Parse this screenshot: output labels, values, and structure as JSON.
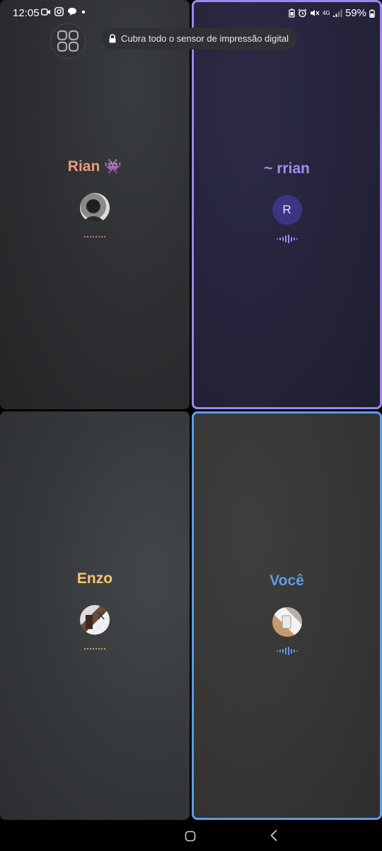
{
  "status_bar": {
    "time": "12:05",
    "left_icons": [
      "video-icon",
      "instagram-icon",
      "chat-bubble-icon",
      "dot-icon"
    ],
    "right_icons": [
      "battery-saver-icon",
      "alarm-icon",
      "mute-icon",
      "4g-icon",
      "signal-icon"
    ],
    "network": "4G",
    "battery_percent": "59%"
  },
  "toast": {
    "icon": "lock-icon",
    "message": "Cubra todo o sensor de impressão digital"
  },
  "participants": [
    {
      "name": "Rian",
      "emoji": "👾",
      "color": "#f09a78",
      "avatar": "photo",
      "avatar_letter": "",
      "speaking": false,
      "highlighted": false
    },
    {
      "name": "~ rrian",
      "emoji": "",
      "color": "#a58cf0",
      "avatar": "letter",
      "avatar_letter": "R",
      "speaking": true,
      "highlighted": true
    },
    {
      "name": "Enzo",
      "emoji": "",
      "color": "#f7c86a",
      "avatar": "photo",
      "avatar_letter": "",
      "speaking": false,
      "highlighted": false
    },
    {
      "name": "Você",
      "emoji": "",
      "color": "#5f9be8",
      "avatar": "photo",
      "avatar_letter": "",
      "speaking": true,
      "highlighted": true
    }
  ],
  "nav_bar": {
    "icons": [
      "home-icon",
      "back-icon"
    ]
  }
}
